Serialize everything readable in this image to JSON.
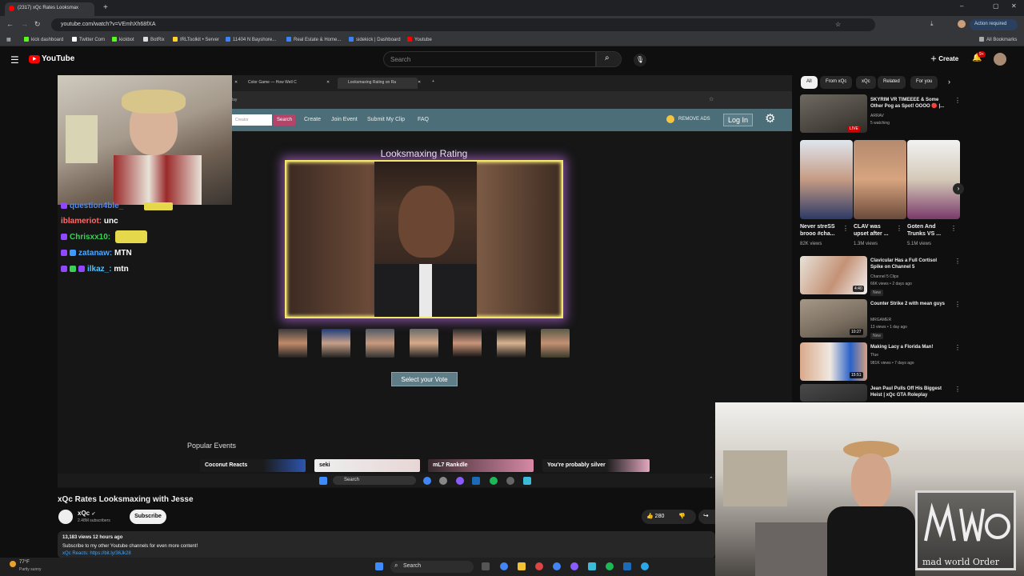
{
  "browser": {
    "tabs": [
      {
        "label": "(2317) xQc Rates Looksmax"
      }
    ],
    "url": "youtube.com/watch?v=VEmhXh68fXA",
    "action_required": "Action required",
    "all_bookmarks": "All Bookmarks",
    "bookmarks": [
      "kick dashboard",
      "Twitter Com",
      "kickbot",
      "BotRix",
      "IRLToolkit • Server",
      "11404 N Bayshore...",
      "Real Estate & Home...",
      "sidekick | Dashboard",
      "Youtube"
    ]
  },
  "youtube": {
    "logo": "YouTube",
    "search_placeholder": "Search",
    "create_label": "Create",
    "notif_count": "9+"
  },
  "video": {
    "inner_tabs": [
      "Color Game — How Well C",
      "Looksmaxing Rating on Ra"
    ],
    "inner_url": "lay",
    "site_nav": {
      "search_placeholder": "Creator",
      "search_btn": "Search",
      "links": [
        "Create",
        "Join Event",
        "Submit My Clip",
        "FAQ"
      ],
      "remove_ads": "REMOVE ADS",
      "login": "Log In"
    },
    "heading": "Looksmaxing Rating",
    "vote_button": "Select your Vote",
    "popular_events_title": "Popular Events",
    "events": [
      "Coconut Reacts",
      "seki",
      "mL7 Rankdle",
      "You're probably silver"
    ],
    "inner_taskbar_search": "Search",
    "chat": [
      {
        "user": "question4ble_",
        "msg": "",
        "color": "#4d8cff"
      },
      {
        "user": "iblameriot:",
        "msg": "unc",
        "color": "#ff6b6b"
      },
      {
        "user": "Chrisxx10:",
        "msg": "",
        "color": "#3ad15a"
      },
      {
        "user": "zatanaw:",
        "msg": "MTN",
        "color": "#4aa8ff"
      },
      {
        "user": "ilkaz_:",
        "msg": "mtn",
        "color": "#4cc3ff"
      }
    ]
  },
  "video_info": {
    "title": "xQc Rates Looksmaxing with Jesse",
    "channel": "xQc",
    "subscribers": "2.48M subscribers",
    "subscribe_label": "Subscribe",
    "likes": "280",
    "stats": "13,183 views  12 hours ago",
    "desc_line1": "Subscribe to my other Youtube channels for even more content!",
    "desc_line2": "xQc Reacts: https://bit.ly/36Jk28"
  },
  "chips": [
    "All",
    "From xQc",
    "xQc",
    "Related",
    "For you"
  ],
  "recommendations": [
    {
      "title": "SKYRIM VR TIMEEEE & Some Other Pog as Spot! OOOO 🔴 |...",
      "channel": "ARRAV",
      "meta": "5 watching",
      "badge": "LIVE"
    },
    {
      "title": "Clavicular Has a Full Cortisol Spike on Channel 5",
      "channel": "Channel 5 Clips",
      "meta": "66K views • 2 days ago",
      "badge": "New",
      "duration": "4:40"
    },
    {
      "title": "Counter Strike 2  with mean guys",
      "channel": "MRGAMER",
      "meta": "13 views • 1 day ago",
      "badge": "New",
      "duration": "10:27"
    },
    {
      "title": "Making Lacy a Florida Man!",
      "channel": "Tfue",
      "meta": "981K views • 7 days ago",
      "duration": "15:51"
    },
    {
      "title": "Jean Paul Pulls Off His Biggest Heist | xQc GTA Roleplay",
      "channel": "",
      "meta": ""
    }
  ],
  "shorts": [
    {
      "title": "Never streSS brooo #cha...",
      "views": "82K views"
    },
    {
      "title": "CLAV was upset after ...",
      "views": "1.3M views"
    },
    {
      "title": "Goten And Trunks VS ...",
      "views": "5.1M views"
    }
  ],
  "watermark": "mad world Order",
  "taskbar": {
    "weather_temp": "77°F",
    "weather_desc": "Partly sunny",
    "search": "Search"
  }
}
